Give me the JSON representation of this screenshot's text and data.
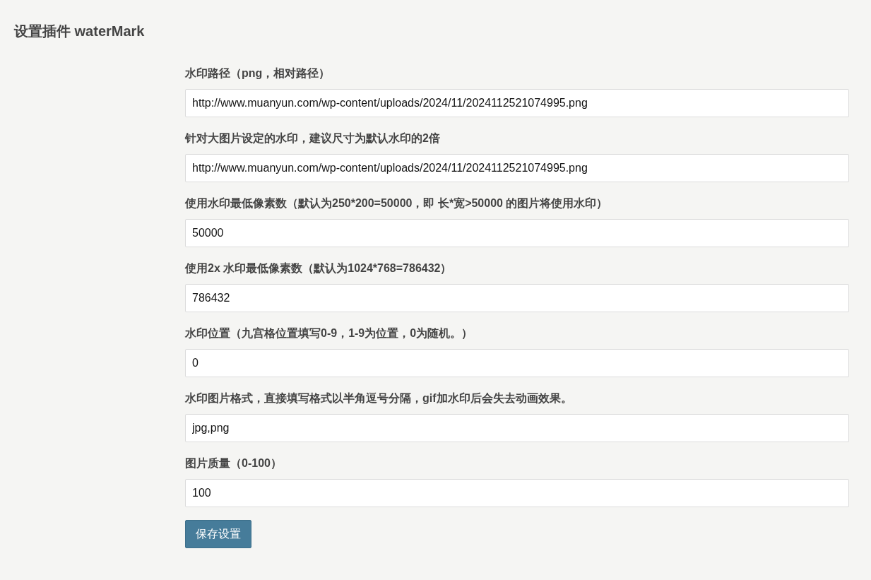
{
  "title": "设置插件 waterMark",
  "fields": [
    {
      "label": "水印路径（png，相对路径）",
      "value": "http://www.muanyun.com/wp-content/uploads/2024/11/2024112521074995.png"
    },
    {
      "label": "针对大图片设定的水印，建议尺寸为默认水印的2倍",
      "value": "http://www.muanyun.com/wp-content/uploads/2024/11/2024112521074995.png"
    },
    {
      "label": "使用水印最低像素数（默认为250*200=50000，即 长*宽>50000 的图片将使用水印）",
      "value": "50000"
    },
    {
      "label": "使用2x 水印最低像素数（默认为1024*768=786432）",
      "value": "786432"
    },
    {
      "label": "水印位置（九宫格位置填写0-9，1-9为位置，0为随机。）",
      "value": "0"
    },
    {
      "label": "水印图片格式，直接填写格式以半角逗号分隔，gif加水印后会失去动画效果。",
      "value": "jpg,png"
    },
    {
      "label": "图片质量（0-100）",
      "value": "100"
    }
  ],
  "save_button": "保存设置"
}
